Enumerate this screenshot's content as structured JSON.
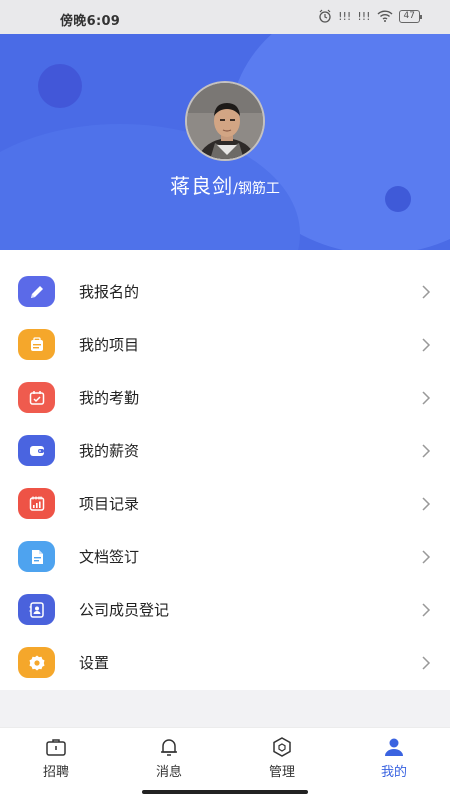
{
  "status_bar": {
    "time": "傍晚6:09",
    "signal_1": "!!!",
    "signal_2": "!!!",
    "battery": "47"
  },
  "profile": {
    "name": "蒋良剑",
    "role": "/钢筋工"
  },
  "menu": {
    "items": [
      {
        "label": "我报名的",
        "icon": "pencil-icon",
        "color": "#5b6ae8"
      },
      {
        "label": "我的项目",
        "icon": "briefcase-icon",
        "color": "#f5a72b"
      },
      {
        "label": "我的考勤",
        "icon": "calendar-check-icon",
        "color": "#ef5b4e"
      },
      {
        "label": "我的薪资",
        "icon": "wallet-icon",
        "color": "#4a64e0"
      },
      {
        "label": "项目记录",
        "icon": "chart-calendar-icon",
        "color": "#ee5346"
      },
      {
        "label": "文档签订",
        "icon": "document-icon",
        "color": "#4ea3ef"
      },
      {
        "label": "公司成员登记",
        "icon": "id-card-icon",
        "color": "#4a62dc"
      },
      {
        "label": "设置",
        "icon": "gear-icon",
        "color": "#f5a72b"
      }
    ]
  },
  "tabbar": {
    "tabs": [
      {
        "label": "招聘",
        "icon": "job-bag-icon"
      },
      {
        "label": "消息",
        "icon": "bell-icon"
      },
      {
        "label": "管理",
        "icon": "hexagon-icon"
      },
      {
        "label": "我的",
        "icon": "user-icon",
        "active": true
      }
    ],
    "active_color": "#3a63e0"
  },
  "colors": {
    "header": "#4a6be6",
    "background": "#f2f2f4"
  }
}
